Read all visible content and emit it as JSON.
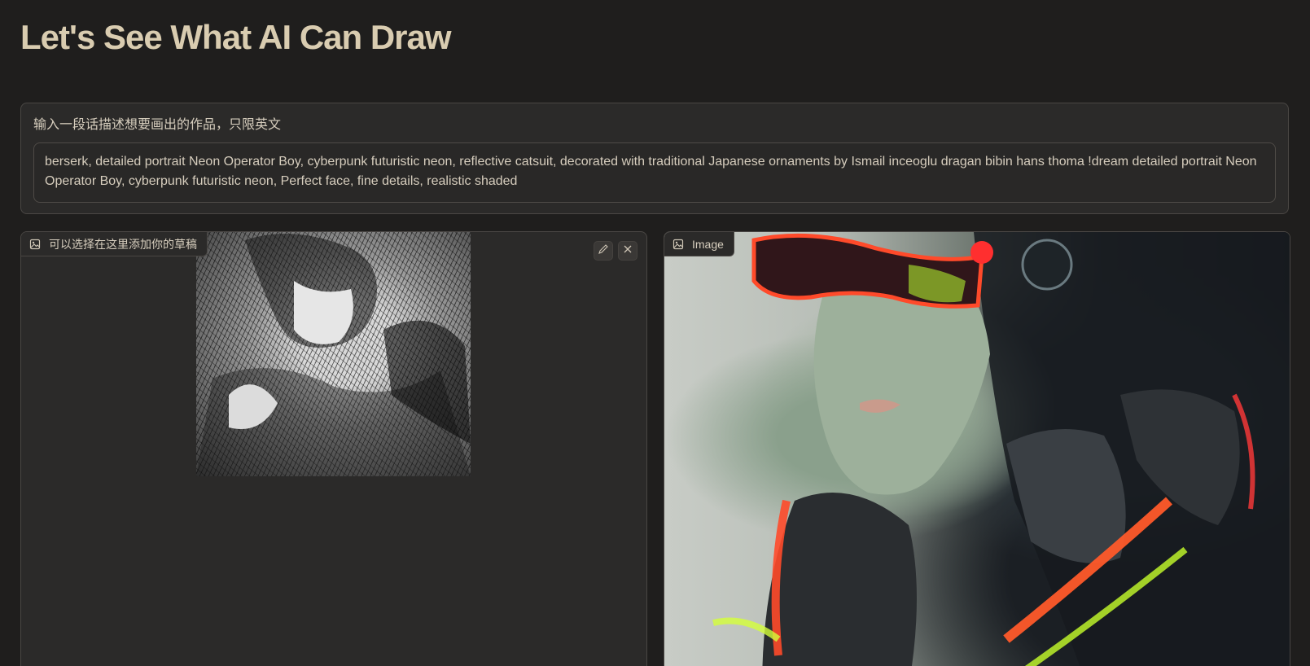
{
  "app": {
    "title": "Let's See What AI Can Draw"
  },
  "prompt": {
    "label": "输入一段话描述想要画出的作品，只限英文",
    "value": "berserk, detailed portrait Neon Operator Boy, cyberpunk futuristic neon, reflective catsuit, decorated with traditional Japanese ornaments by Ismail inceoglu dragan bibin hans thoma !dream detailed portrait Neon Operator Boy, cyberpunk futuristic neon,  Perfect face, fine details, realistic shaded"
  },
  "sketch_panel": {
    "label": "可以选择在这里添加你的草稿",
    "icon": "image-icon",
    "edit_icon": "pencil-icon",
    "clear_icon": "close-icon"
  },
  "output_panel": {
    "label": "Image",
    "icon": "image-icon"
  },
  "colors": {
    "background": "#1f1e1d",
    "panel": "#2b2a29",
    "border": "#4a4744",
    "title": "#d9ccb0",
    "text": "#d6cdbd",
    "neon": "#ff4a2a"
  }
}
